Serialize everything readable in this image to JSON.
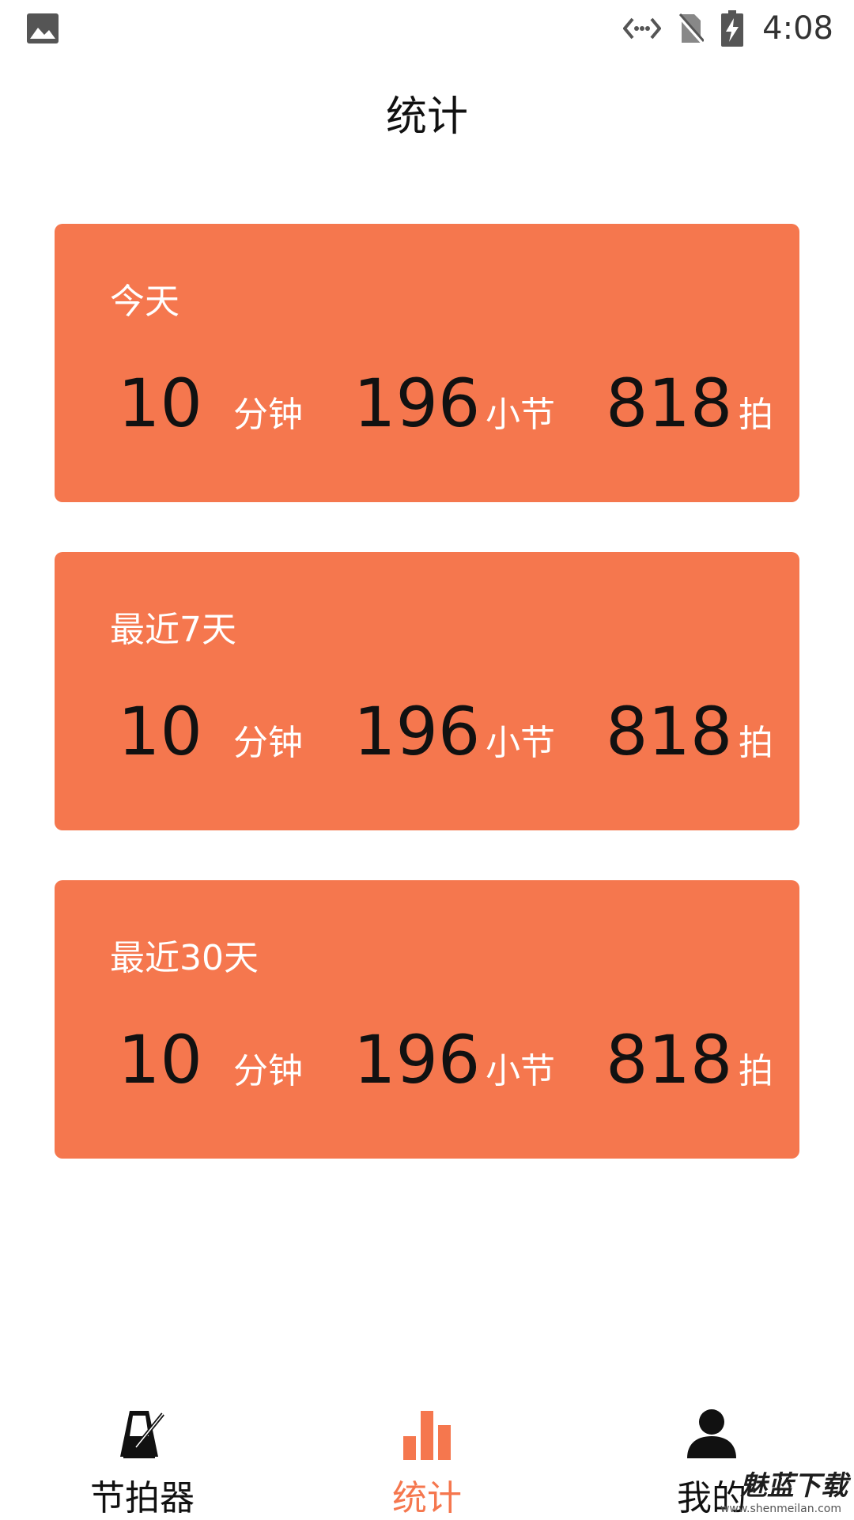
{
  "status_bar": {
    "time": "4:08",
    "icons": [
      "gallery-icon",
      "network-sync-icon",
      "no-sim-icon",
      "battery-charging-icon"
    ]
  },
  "header": {
    "title": "统计"
  },
  "cards": [
    {
      "label": "今天",
      "minutes": "10",
      "minutes_unit": "分钟",
      "measures": "196",
      "measures_unit": "小节",
      "beats": "818",
      "beats_unit": "拍"
    },
    {
      "label": "最近7天",
      "minutes": "10",
      "minutes_unit": "分钟",
      "measures": "196",
      "measures_unit": "小节",
      "beats": "818",
      "beats_unit": "拍"
    },
    {
      "label": "最近30天",
      "minutes": "10",
      "minutes_unit": "分钟",
      "measures": "196",
      "measures_unit": "小节",
      "beats": "818",
      "beats_unit": "拍"
    }
  ],
  "bottom_nav": {
    "items": [
      {
        "label": "节拍器",
        "icon": "metronome-icon",
        "active": false
      },
      {
        "label": "统计",
        "icon": "bar-chart-icon",
        "active": true
      },
      {
        "label": "我的",
        "icon": "person-icon",
        "active": false
      }
    ]
  },
  "watermark": {
    "text": "魅蓝下载",
    "url": "www.shenmeilan.com"
  },
  "colors": {
    "accent": "#F5774E",
    "card_bg": "#F5774E",
    "text_dark": "#111111",
    "text_light": "#FFFFFF"
  }
}
